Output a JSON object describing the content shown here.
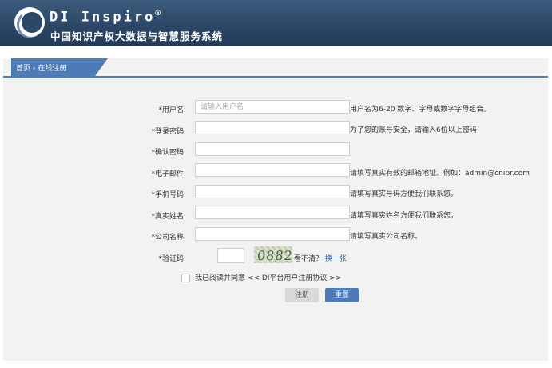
{
  "header": {
    "brand_name": "DI Inspiro",
    "brand_mark": "®",
    "subtitle": "中国知识产权大数据与智慧服务系统"
  },
  "breadcrumb": {
    "home": "首页",
    "separator": " › ",
    "current": "在线注册"
  },
  "form": {
    "username": {
      "label": "*用户名:",
      "placeholder": "请输入用户名",
      "value": "",
      "hint": "用户名为6-20 数字、字母或数字字母组合。"
    },
    "password": {
      "label": "*登录密码:",
      "value": "",
      "hint": "为了您的账号安全，请输入6位以上密码"
    },
    "confirm": {
      "label": "*确认密码:",
      "value": ""
    },
    "email": {
      "label": "*电子邮件:",
      "value": "",
      "hint": "请填写真实有效的邮箱地址。例如：admin@cnipr.com"
    },
    "phone": {
      "label": "*手机号码:",
      "value": "",
      "hint": "请填写真实号码方便我们联系您。"
    },
    "realname": {
      "label": "*真实姓名:",
      "value": "",
      "hint": "请填写真实姓名方便我们联系您。"
    },
    "company": {
      "label": "*公司名称:",
      "value": "",
      "hint": "请填写真实公司名称。"
    },
    "captcha": {
      "label": "*验证码:",
      "value": "",
      "image_text": "0882",
      "unclear": "看不清？",
      "refresh": "换一张"
    }
  },
  "agreement": {
    "checked": false,
    "text": "我已阅读并同意",
    "link": "<< DI平台用户注册协议 >>"
  },
  "buttons": {
    "register": "注册",
    "reset": "重置"
  },
  "colors": {
    "header_bg": "#2d4767",
    "accent": "#4d7bb8",
    "panel_bg": "#f2f2f2"
  }
}
